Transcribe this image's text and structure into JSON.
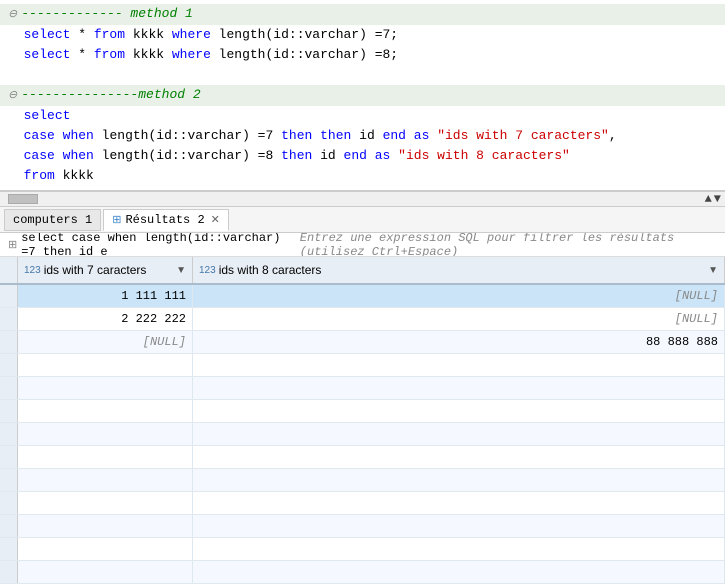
{
  "editor": {
    "method1": {
      "header": "------------- method 1",
      "line1": "select * from kkkk where length(id::varchar) =7;",
      "line2": "select * from kkkk where length(id::varchar) =8;"
    },
    "method2": {
      "header": "---------------method 2",
      "line1": "select",
      "line2": "case when length(id::varchar) =7 then id end as \"ids with 7 caracters\",",
      "line3": "case when length(id::varchar) =8 then id end as \"ids with 8 caracters\"",
      "line4": "from kkkk"
    }
  },
  "tabs": [
    {
      "id": "computers1",
      "label": "computers 1",
      "active": false,
      "closeable": false,
      "icon": false
    },
    {
      "id": "resultats2",
      "label": "Résultats 2",
      "active": true,
      "closeable": true,
      "icon": true
    }
  ],
  "query_bar": {
    "query_text": "select case when length(id::varchar) =7 then id e",
    "icon": "⊞",
    "hint": "Entrez une expression SQL pour filtrer les résultats (utilisez Ctrl+Espace)"
  },
  "grid": {
    "columns": [
      {
        "id": "col1",
        "type_icon": "123",
        "label": "ids with 7 caracters"
      },
      {
        "id": "col2",
        "type_icon": "123",
        "label": "ids with 8 caracters"
      }
    ],
    "rows": [
      {
        "num": "",
        "col1": "1 111 111",
        "col2": "[NULL]",
        "selected": true
      },
      {
        "num": "",
        "col1": "2 222 222",
        "col2": "[NULL]",
        "selected": false
      },
      {
        "num": "",
        "col1": "[NULL]",
        "col2": "88 888 888",
        "selected": false
      }
    ],
    "empty_row_count": 10
  }
}
